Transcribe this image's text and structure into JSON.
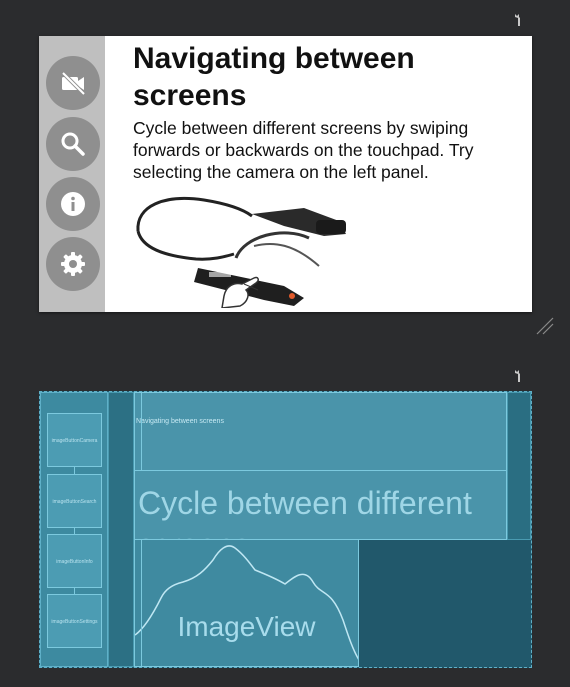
{
  "design": {
    "title": "Navigating between screens",
    "body": "Cycle between different screens by swiping forwards or backwards on the touchpad. Try selecting the camera on the left panel.",
    "side_buttons": [
      {
        "icon": "videocam-off-icon"
      },
      {
        "icon": "search-icon"
      },
      {
        "icon": "info-icon"
      },
      {
        "icon": "settings-icon"
      }
    ],
    "image": {
      "icon": "smart-glasses-image"
    }
  },
  "blueprint": {
    "title_label": "Navigating between screens",
    "body_label": "Cycle between different screens",
    "image_label": "ImageView",
    "buttons": [
      {
        "label": "imageButtonCamera"
      },
      {
        "label": "imageButtonSearch"
      },
      {
        "label": "imageButtonInfo"
      },
      {
        "label": "imageButtonSettings"
      }
    ]
  },
  "colors": {
    "canvas_bg": "#2b2c2e",
    "panel_gray": "#bfbfbf",
    "button_gray": "#8f8f8f",
    "blueprint_bg": "#21586b",
    "blueprint_accent": "#7cc9de"
  }
}
